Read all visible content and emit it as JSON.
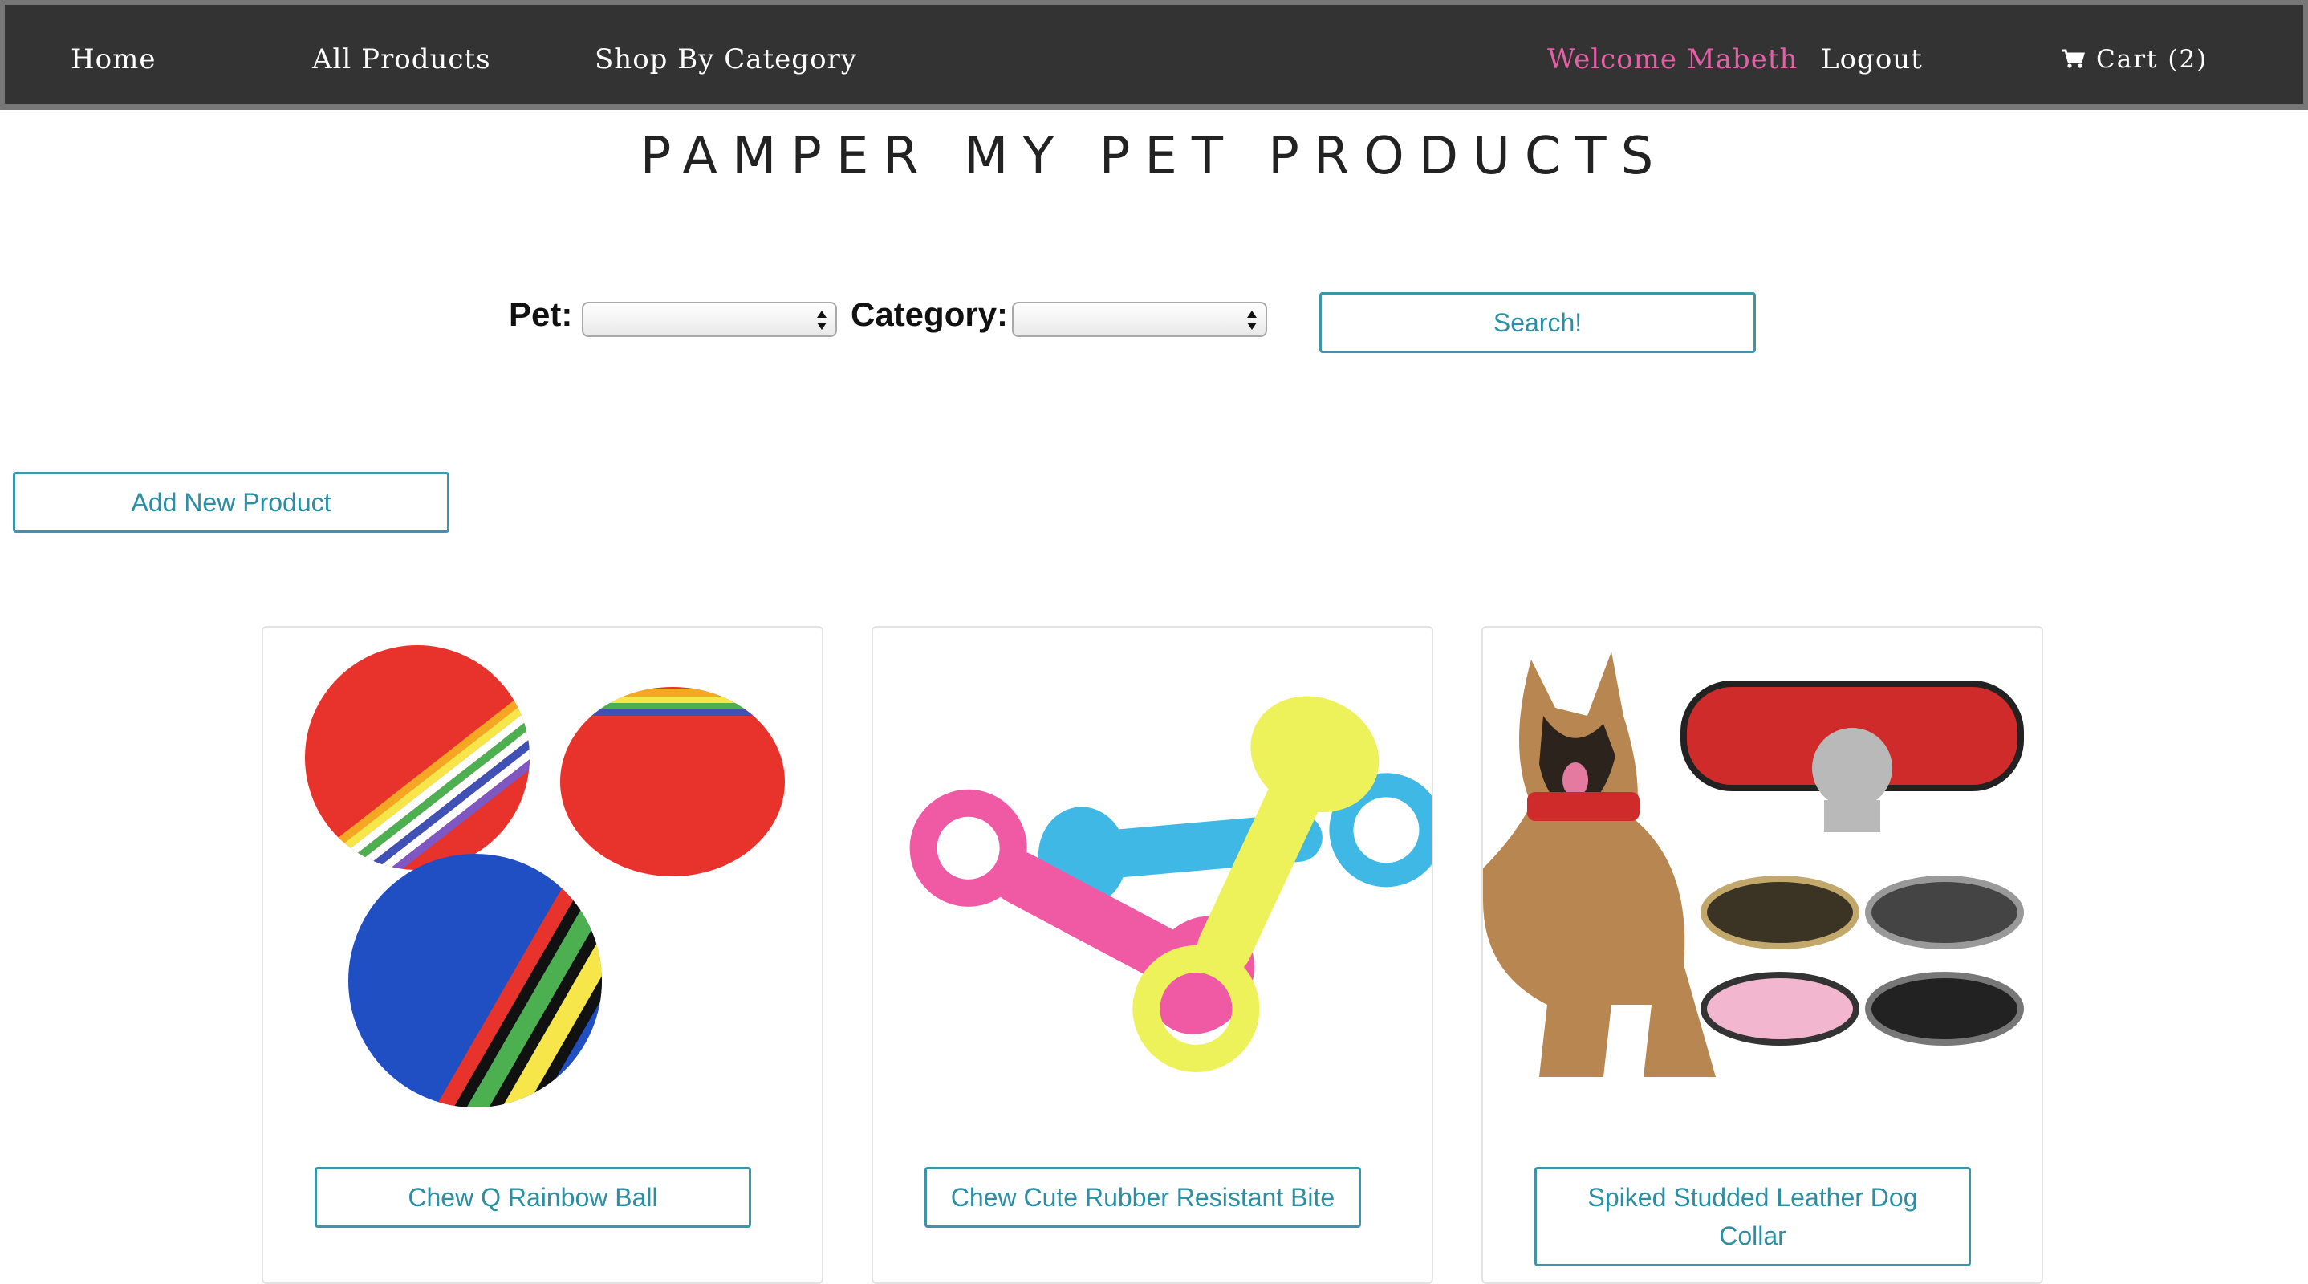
{
  "nav": {
    "home": "Home",
    "all_products": "All Products",
    "shop_by_category": "Shop By Category",
    "welcome": "Welcome Mabeth",
    "logout": "Logout",
    "cart": "Cart (2)"
  },
  "title": "PAMPER MY PET PRODUCTS",
  "filters": {
    "pet_label": "Pet:",
    "pet_value": "",
    "category_label": "Category:",
    "category_value": "",
    "search_button": "Search!"
  },
  "add_new_product": "Add New Product",
  "products": [
    {
      "name": "Chew Q Rainbow Ball",
      "image": "rainbow-balls"
    },
    {
      "name": "Chew Cute Rubber Resistant Bite",
      "image": "rubber-bones"
    },
    {
      "name": "Spiked Studded Leather Dog Collar",
      "image": "dog-collars"
    }
  ],
  "colors": {
    "navbar_bg": "#333333",
    "welcome_pink": "#e35fa6",
    "button_teal": "#3a96a8"
  },
  "icons": {
    "cart": "shopping-cart-icon",
    "select": "select-arrows-icon"
  }
}
